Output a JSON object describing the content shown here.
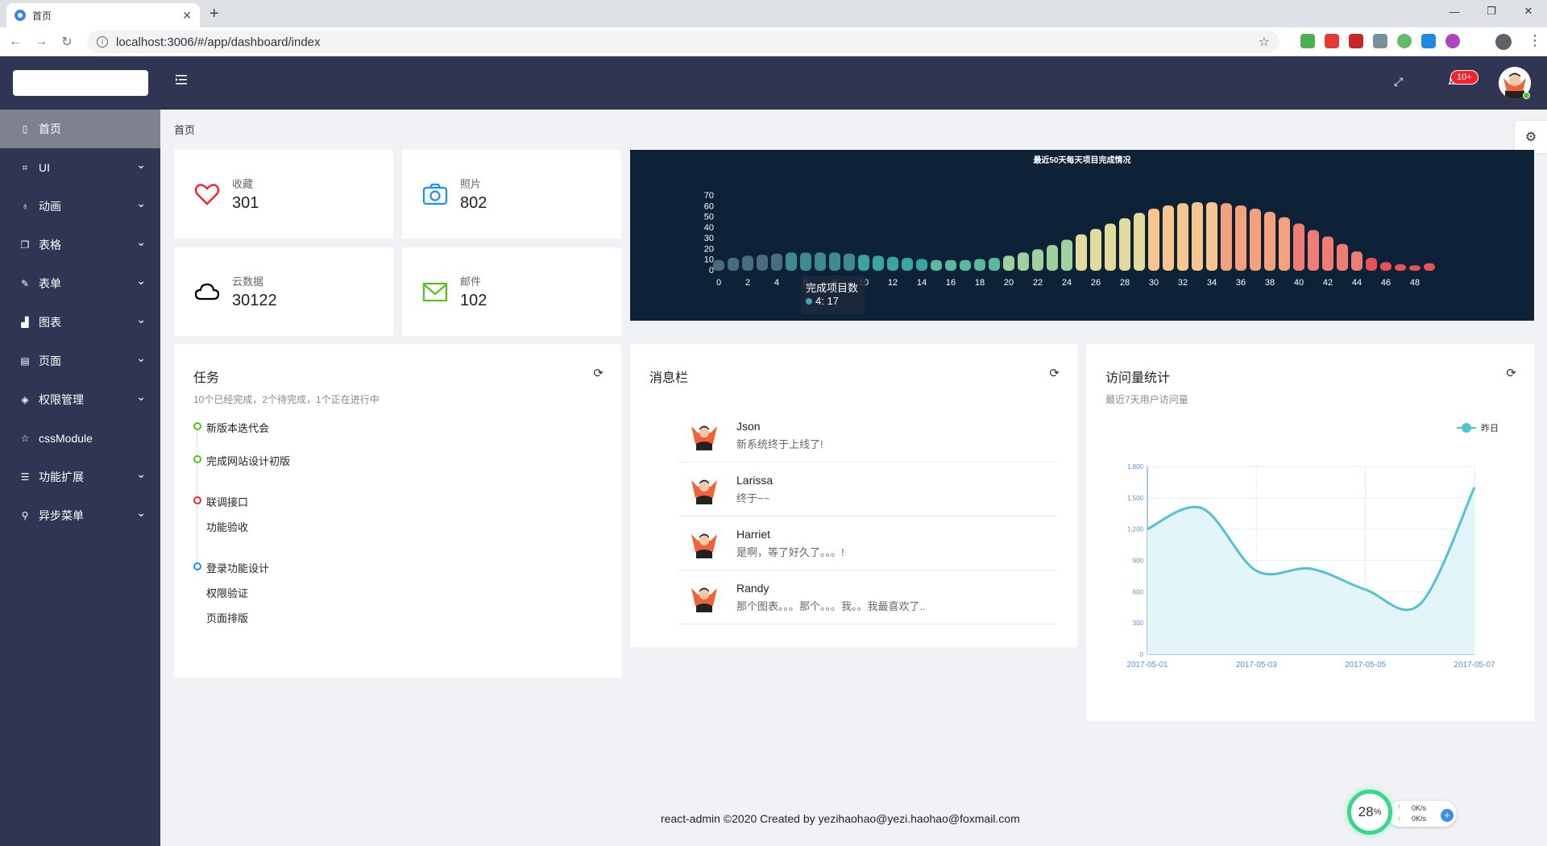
{
  "browser": {
    "tab_title": "首页",
    "url": "localhost:3006/#/app/dashboard/index"
  },
  "header": {
    "badge": "10+"
  },
  "sidebar": {
    "items": [
      {
        "label": "首页",
        "icon": "mobile-icon",
        "has_caret": false
      },
      {
        "label": "UI",
        "icon": "scan-icon",
        "has_caret": true
      },
      {
        "label": "动画",
        "icon": "rocket-icon",
        "has_caret": true
      },
      {
        "label": "表格",
        "icon": "copy-icon",
        "has_caret": true
      },
      {
        "label": "表单",
        "icon": "edit-icon",
        "has_caret": true
      },
      {
        "label": "图表",
        "icon": "area-chart-icon",
        "has_caret": true
      },
      {
        "label": "页面",
        "icon": "switcher-icon",
        "has_caret": true
      },
      {
        "label": "权限管理",
        "icon": "safety-icon",
        "has_caret": true
      },
      {
        "label": "cssModule",
        "icon": "star-icon",
        "has_caret": false
      },
      {
        "label": "功能扩展",
        "icon": "bars-icon",
        "has_caret": true
      },
      {
        "label": "异步菜单",
        "icon": "api-icon",
        "has_caret": true
      }
    ]
  },
  "breadcrumb": "首页",
  "stats": [
    {
      "label": "收藏",
      "value": "301",
      "icon": "heart-icon",
      "color": "#f5222d"
    },
    {
      "label": "照片",
      "value": "802",
      "icon": "camera-icon",
      "color": "#1890ff"
    },
    {
      "label": "云数据",
      "value": "30122",
      "icon": "cloud-icon",
      "color": "#000000"
    },
    {
      "label": "邮件",
      "value": "102",
      "icon": "mail-icon",
      "color": "#52c41a"
    }
  ],
  "chart_data": {
    "type": "bar",
    "title": "最近50天每天项目完成情况",
    "x": [
      0,
      1,
      2,
      3,
      4,
      5,
      6,
      7,
      8,
      9,
      10,
      11,
      12,
      13,
      14,
      15,
      16,
      17,
      18,
      19,
      20,
      21,
      22,
      23,
      24,
      25,
      26,
      27,
      28,
      29,
      30,
      31,
      32,
      33,
      34,
      35,
      36,
      37,
      38,
      39,
      40,
      41,
      42,
      43,
      44,
      45,
      46,
      47,
      48,
      49
    ],
    "x_tick_labels": [
      "0",
      "2",
      "4",
      "6",
      "8",
      "10",
      "12",
      "14",
      "16",
      "18",
      "20",
      "22",
      "24",
      "26",
      "28",
      "30",
      "32",
      "34",
      "36",
      "38",
      "40",
      "42",
      "44",
      "46",
      "48"
    ],
    "values": [
      10,
      12,
      14,
      15,
      16,
      17,
      17,
      17,
      17,
      16,
      15,
      14,
      13,
      12,
      11,
      10,
      10,
      10,
      11,
      12,
      14,
      17,
      20,
      24,
      29,
      34,
      39,
      44,
      49,
      54,
      58,
      61,
      63,
      64,
      64,
      63,
      61,
      58,
      55,
      50,
      44,
      38,
      32,
      25,
      18,
      12,
      8,
      6,
      5,
      7
    ],
    "ylim": [
      0,
      70
    ],
    "y_tick_labels": [
      "0",
      "10",
      "20",
      "30",
      "40",
      "50",
      "60",
      "70"
    ],
    "tooltip": {
      "title": "完成项目数",
      "label": "4: 17"
    }
  },
  "tasks": {
    "title": "任务",
    "subtitle": "10个已经完成，2个待完成，1个正在进行中",
    "groups": [
      {
        "color": "#52c41a",
        "items": [
          "新版本迭代会"
        ]
      },
      {
        "color": "#52c41a",
        "items": [
          "完成网站设计初版"
        ]
      },
      {
        "color": "#f5222d",
        "items": [
          "联调接口",
          "功能验收"
        ]
      },
      {
        "color": "#1890ff",
        "items": [
          "登录功能设计",
          "权限验证",
          "页面排版"
        ]
      }
    ]
  },
  "messages": {
    "title": "消息栏",
    "items": [
      {
        "name": "Json",
        "text": "新系统终于上线了!"
      },
      {
        "name": "Larissa",
        "text": "终于~~"
      },
      {
        "name": "Harriet",
        "text": "是啊，等了好久了。。。!"
      },
      {
        "name": "Randy",
        "text": "那个图表。。。那个。。。我。。我最喜欢了.."
      }
    ]
  },
  "visits": {
    "title": "访问量统计",
    "subtitle": "最近7天用户访问量",
    "legend": "昨日",
    "chart_data": {
      "type": "area",
      "x_tick_labels": [
        "2017-05-01",
        "2017-05-03",
        "2017-05-05",
        "2017-05-07"
      ],
      "x": [
        "2017-05-01",
        "2017-05-02",
        "2017-05-03",
        "2017-05-04",
        "2017-05-05",
        "2017-05-06",
        "2017-05-07"
      ],
      "values": [
        1200,
        1400,
        800,
        820,
        620,
        480,
        1600
      ],
      "ylim": [
        0,
        1800
      ],
      "y_tick_labels": [
        "0",
        "300",
        "600",
        "900",
        "1,200",
        "1,500",
        "1,800"
      ],
      "color": "#4fc4cf"
    }
  },
  "footer": "react-admin ©2020 Created by yezihaohao@yezi.haohao@foxmail.com",
  "speed_widget": {
    "percent": "28",
    "unit": "%",
    "up": "0K/s",
    "down": "0K/s"
  }
}
